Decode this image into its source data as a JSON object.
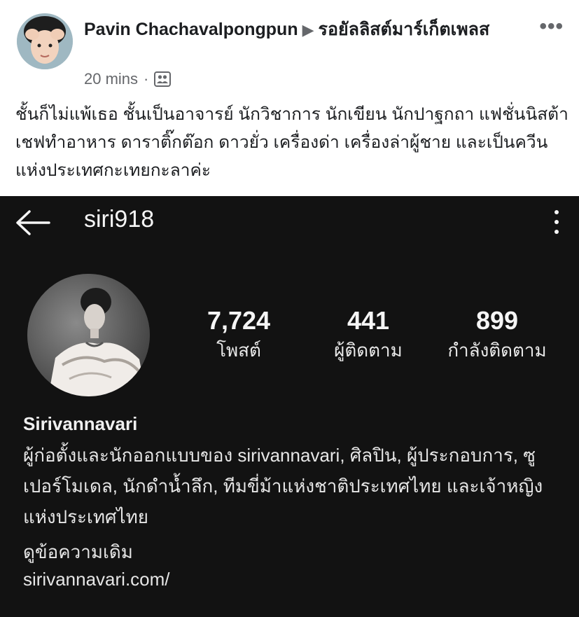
{
  "post": {
    "author": "Pavin Chachavalpongpun",
    "arrow": "▶",
    "group": "รอยัลลิสต์มาร์เก็ตเพลส",
    "time": "20 mins",
    "separator": "·",
    "more_icon": "more-horizontal-icon",
    "text": "ชั้นก็ไม่แพ้เธอ ชั้นเป็นอาจารย์ นักวิชาการ นักเขียน นักปาฐกถา แฟชั่นนิสต้า เชฟทำอาหาร ดาราติ๊กต๊อก ดาวยั่ว เครื่องด่า เครื่องล่าผู้ชาย และเป็นควีนแห่งประเทศกะเทยกะลาค่ะ"
  },
  "instagram": {
    "username": "siri918",
    "stats": [
      {
        "value": "7,724",
        "label": "โพสต์"
      },
      {
        "value": "441",
        "label": "ผู้ติดตาม"
      },
      {
        "value": "899",
        "label": "กำลังติดตาม"
      }
    ],
    "name": "Sirivannavari",
    "bio": "ผู้ก่อตั้งและนักออกแบบของ sirivannavari, ศิลปิน, ผู้ประกอบการ, ซูเปอร์โมเดล, นักดำน้ำลึก, ทีมขี่ม้าแห่งชาติประเทศไทย และเจ้าหญิงแห่งประเทศไทย",
    "see_more": "ดูข้อความเดิม",
    "link": "sirivannavari.com/"
  },
  "colors": {
    "ig_background": "#121212",
    "fb_text": "#1c1e21",
    "fb_secondary": "#65676b"
  }
}
